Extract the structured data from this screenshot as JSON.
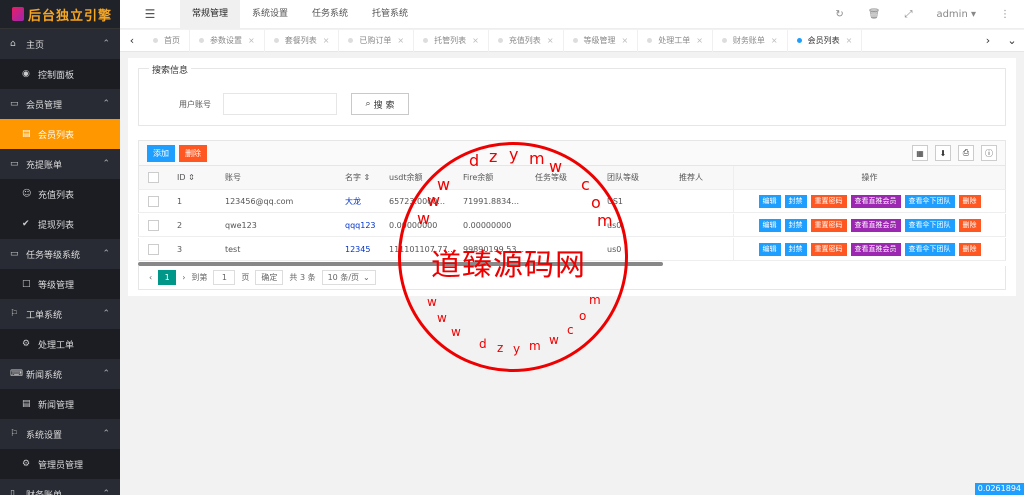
{
  "sidebar": {
    "logo": "后台独立引擎",
    "groups": [
      {
        "label": "主页",
        "icon": "home-icon",
        "items": [
          {
            "label": "控制面板",
            "icon": "dashboard-icon"
          }
        ]
      },
      {
        "label": "会员管理",
        "icon": "member-icon",
        "items": [
          {
            "label": "会员列表",
            "icon": "list-icon",
            "active": true
          }
        ]
      },
      {
        "label": "充提账单",
        "icon": "bill-icon",
        "items": [
          {
            "label": "充值列表",
            "icon": "users-icon"
          },
          {
            "label": "提现列表",
            "icon": "check-circle-icon"
          }
        ]
      },
      {
        "label": "任务等级系统",
        "icon": "task-icon",
        "items": [
          {
            "label": "等级管理",
            "icon": "square-icon"
          }
        ]
      },
      {
        "label": "工单系统",
        "icon": "flag-icon",
        "items": [
          {
            "label": "处理工单",
            "icon": "gear-icon"
          }
        ]
      },
      {
        "label": "新闻系统",
        "icon": "keyboard-icon",
        "items": [
          {
            "label": "新闻管理",
            "icon": "list-icon"
          }
        ]
      },
      {
        "label": "系统设置",
        "icon": "flag-icon",
        "items": [
          {
            "label": "管理员管理",
            "icon": "gear-icon"
          }
        ]
      },
      {
        "label": "财务账单",
        "icon": "phone-icon",
        "items": []
      }
    ]
  },
  "topbar": {
    "tabs": [
      "常规管理",
      "系统设置",
      "任务系统",
      "托管系统"
    ],
    "active": "常规管理",
    "user": "admin"
  },
  "pagetabs": [
    {
      "label": "首页"
    },
    {
      "label": "参数设置"
    },
    {
      "label": "套餐列表"
    },
    {
      "label": "已购订单"
    },
    {
      "label": "托管列表"
    },
    {
      "label": "充值列表"
    },
    {
      "label": "等级管理"
    },
    {
      "label": "处理工单"
    },
    {
      "label": "财务账单"
    },
    {
      "label": "会员列表",
      "active": true
    }
  ],
  "search": {
    "legend": "搜索信息",
    "account_label": "用户账号",
    "account_value": "",
    "button": "搜 索"
  },
  "table": {
    "add": "添加",
    "delete": "删除",
    "headers": [
      "ID",
      "账号",
      "名字",
      "usdt余额",
      "Fire余额",
      "任务等级",
      "团队等级",
      "推荐人",
      "操作"
    ],
    "rows": [
      {
        "id": "1",
        "account": "123456@qq.com",
        "name": "大龙",
        "usdt": "65723.0000...",
        "fire": "71991.8834...",
        "task": "",
        "team": "US1",
        "ref": ""
      },
      {
        "id": "2",
        "account": "qwe123",
        "name": "qqq123",
        "usdt": "0.00000000",
        "fire": "0.00000000",
        "task": "",
        "team": "us0",
        "ref": ""
      },
      {
        "id": "3",
        "account": "test",
        "name": "12345",
        "usdt": "111101107.77...",
        "fire": "99890199.53...",
        "task": "",
        "team": "us0",
        "ref": ""
      }
    ],
    "actions": [
      "编辑",
      "封禁",
      "重置密码",
      "查看直推会员",
      "查看伞下团队",
      "删除"
    ]
  },
  "pager": {
    "current": "1",
    "goto_label": "到第",
    "goto_value": "1",
    "page_unit": "页",
    "confirm": "确定",
    "total": "共 3 条",
    "per_page": "10 条/页"
  },
  "stamp": {
    "center": "道臻源码网"
  },
  "corner_value": "0.0261894"
}
